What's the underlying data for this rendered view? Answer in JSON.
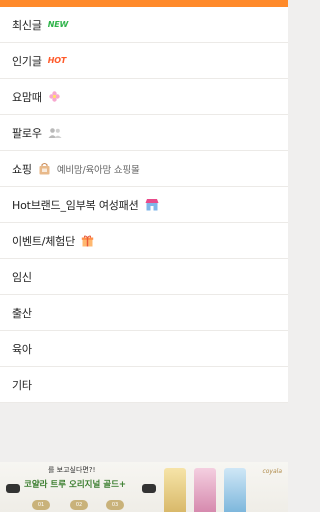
{
  "menu": {
    "items": [
      {
        "label": "최신글",
        "badge": "NEW"
      },
      {
        "label": "인기글",
        "badge": "HOT"
      },
      {
        "label": "요맘때"
      },
      {
        "label": "팔로우"
      },
      {
        "label": "쇼핑",
        "sub": "예비맘/육아맘 쇼핑몰"
      },
      {
        "label": "Hot브랜드_임부복 여성패션"
      },
      {
        "label": "이벤트/체험단"
      },
      {
        "label": "임신"
      },
      {
        "label": "출산"
      },
      {
        "label": "육아"
      },
      {
        "label": "기타"
      }
    ]
  },
  "ad": {
    "question": "를 보고싶다면?!",
    "title": "코얄라 트루 오리지널 골드+",
    "chips": [
      "01",
      "02",
      "03"
    ],
    "logo": "coyala"
  },
  "colors": {
    "accent": "#ff8a2a",
    "new": "#2fb44a",
    "hot": "#ff5a2a"
  }
}
